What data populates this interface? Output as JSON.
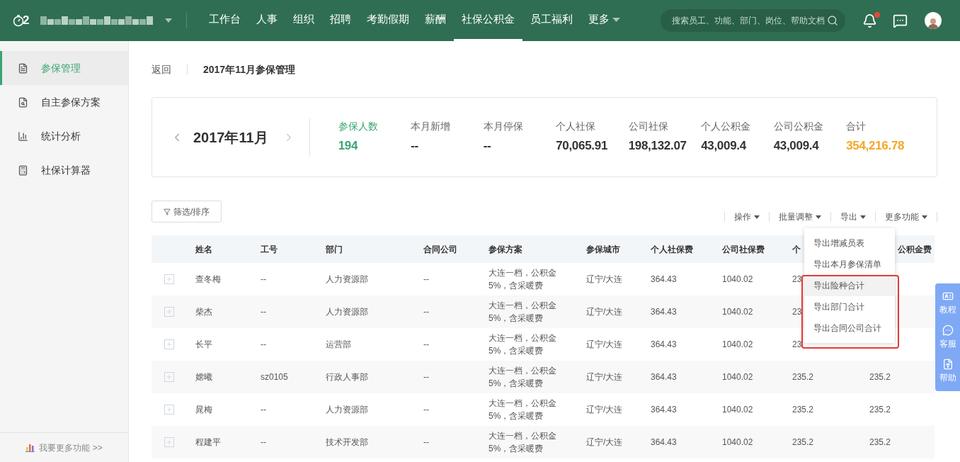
{
  "header": {
    "logo_text": "2",
    "nav": [
      {
        "label": "工作台",
        "selected": false
      },
      {
        "label": "人事",
        "selected": false
      },
      {
        "label": "组织",
        "selected": false
      },
      {
        "label": "招聘",
        "selected": false
      },
      {
        "label": "考勤假期",
        "selected": false
      },
      {
        "label": "薪酬",
        "selected": false
      },
      {
        "label": "社保公积金",
        "selected": true
      },
      {
        "label": "员工福利",
        "selected": false
      }
    ],
    "more": "更多",
    "search": {
      "placeholder": "搜索员工、功能、部门、岗位、帮助文档"
    },
    "unread": true
  },
  "sidebar": {
    "items": [
      {
        "label": "参保管理",
        "selected": true
      },
      {
        "label": "自主参保方案",
        "selected": false
      },
      {
        "label": "统计分析",
        "selected": false
      },
      {
        "label": "社保计算器",
        "selected": false
      }
    ],
    "footer": "我要更多功能 >>"
  },
  "breadcrumb": {
    "back": "返回",
    "title": "2017年11月参保管理"
  },
  "summary": {
    "month": "2017年11月",
    "stats": [
      {
        "label": "参保人数",
        "value": "194",
        "selected": true,
        "color": "#3aa574"
      },
      {
        "label": "本月新增",
        "value": "--",
        "selected": false,
        "color": "#333333"
      },
      {
        "label": "本月停保",
        "value": "--",
        "selected": false,
        "color": "#333333"
      },
      {
        "label": "个人社保",
        "value": "70,065.91",
        "selected": false,
        "color": "#333333"
      },
      {
        "label": "公司社保",
        "value": "198,132.07",
        "selected": false,
        "color": "#333333"
      },
      {
        "label": "个人公积金",
        "value": "43,009.4",
        "selected": false,
        "color": "#333333"
      },
      {
        "label": "公司公积金",
        "value": "43,009.4",
        "selected": false,
        "color": "#333333"
      },
      {
        "label": "合计",
        "value": "354,216.78",
        "selected": false,
        "color": "#f5a623"
      }
    ]
  },
  "filter_button": "筛选/排序",
  "toolbar": [
    "操作",
    "批量调整",
    "导出",
    "更多功能"
  ],
  "export_menu": {
    "framed": true,
    "items": [
      {
        "label": "导出增减员表",
        "selected": false
      },
      {
        "label": "导出本月参保清单",
        "selected": false
      },
      {
        "label": "导出险种合计",
        "selected": true
      },
      {
        "label": "导出部门合计",
        "selected": false
      },
      {
        "label": "导出合同公司合计",
        "selected": false
      }
    ]
  },
  "table": {
    "columns": [
      "姓名",
      "工号",
      "部门",
      "合同公司",
      "参保方案",
      "参保城市",
      "个人社保费",
      "公司社保费",
      "个",
      "公积金费"
    ],
    "rows": [
      {
        "cells": [
          "查冬梅",
          "--",
          "人力资源部",
          "--",
          "大连一档，公积金5%，含采暖费",
          "辽宁/大连",
          "364.43",
          "1040.02",
          "23",
          null
        ]
      },
      {
        "cells": [
          "柴杰",
          "--",
          "人力资源部",
          "--",
          "大连一档，公积金5%，含采暖费",
          "辽宁/大连",
          "364.43",
          "1040.02",
          "23",
          null
        ]
      },
      {
        "cells": [
          "长平",
          "--",
          "运营部",
          "--",
          "大连一档，公积金5%，含采暖费",
          "辽宁/大连",
          "364.43",
          "1040.02",
          "23",
          null
        ]
      },
      {
        "cells": [
          "嫦曦",
          "sz0105",
          "行政人事部",
          "--",
          "大连一档，公积金5%，含采暖费",
          "辽宁/大连",
          "364.43",
          "1040.02",
          "235.2",
          "235.2"
        ]
      },
      {
        "cells": [
          "晁梅",
          "--",
          "人力资源部",
          "--",
          "大连一档，公积金5%，含采暖费",
          "辽宁/大连",
          "364.43",
          "1040.02",
          "235.2",
          "235.2"
        ]
      },
      {
        "cells": [
          "程建平",
          "--",
          "技术开发部",
          "--",
          "大连一档，公积金5%，含采暖费",
          "辽宁/大连",
          "364.43",
          "1040.02",
          "235.2",
          "235.2"
        ]
      }
    ]
  },
  "float_panel": [
    "教程",
    "客服",
    "帮助"
  ]
}
